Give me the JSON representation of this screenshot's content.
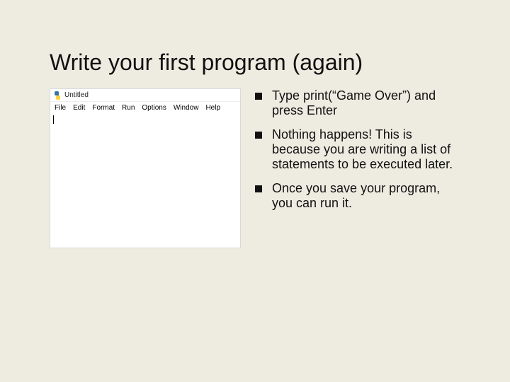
{
  "title": "Write your first program (again)",
  "editor": {
    "window_title": "Untitled",
    "menu": [
      "File",
      "Edit",
      "Format",
      "Run",
      "Options",
      "Window",
      "Help"
    ]
  },
  "bullets": [
    "Type print(“Game Over”) and press Enter",
    "Nothing happens! This is because you are writing a list of statements to be executed later.",
    "Once you save your program, you can run it."
  ]
}
